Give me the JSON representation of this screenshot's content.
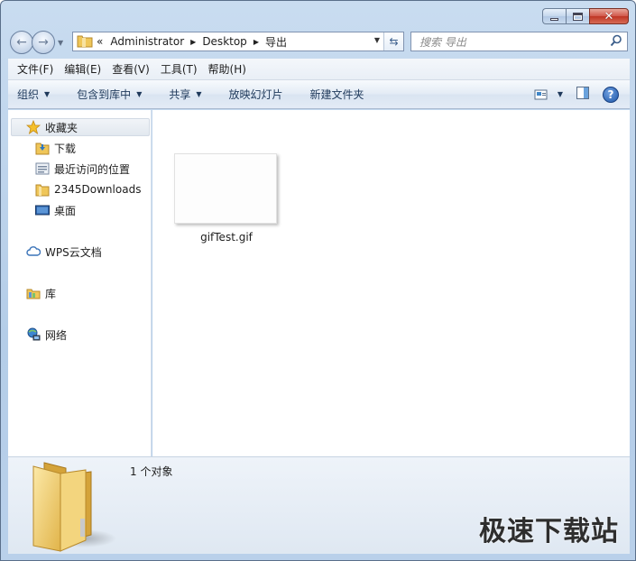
{
  "window": {
    "caption_buttons": [
      "minimize",
      "maximize",
      "close"
    ]
  },
  "address": {
    "overflow": "«",
    "crumbs": [
      "Administrator",
      "Desktop",
      "导出"
    ]
  },
  "search": {
    "placeholder": "搜索 导出"
  },
  "menu": [
    "文件(F)",
    "编辑(E)",
    "查看(V)",
    "工具(T)",
    "帮助(H)"
  ],
  "commands": {
    "organize": "组织",
    "include_in_library": "包含到库中",
    "share": "共享",
    "slideshow": "放映幻灯片",
    "new_folder": "新建文件夹",
    "help": "?"
  },
  "navpane": {
    "favorites": "收藏夹",
    "favorites_items": [
      "下载",
      "最近访问的位置",
      "2345Downloads",
      "桌面"
    ],
    "wps": "WPS云文档",
    "libraries": "库",
    "network": "网络"
  },
  "files": [
    {
      "name": "gifTest.gif"
    }
  ],
  "details": {
    "count": "1 个对象"
  },
  "watermark": "极速下载站",
  "colors": {
    "accent": "#1e395b",
    "frame": "#b9d0ea",
    "close": "#c7402e"
  }
}
